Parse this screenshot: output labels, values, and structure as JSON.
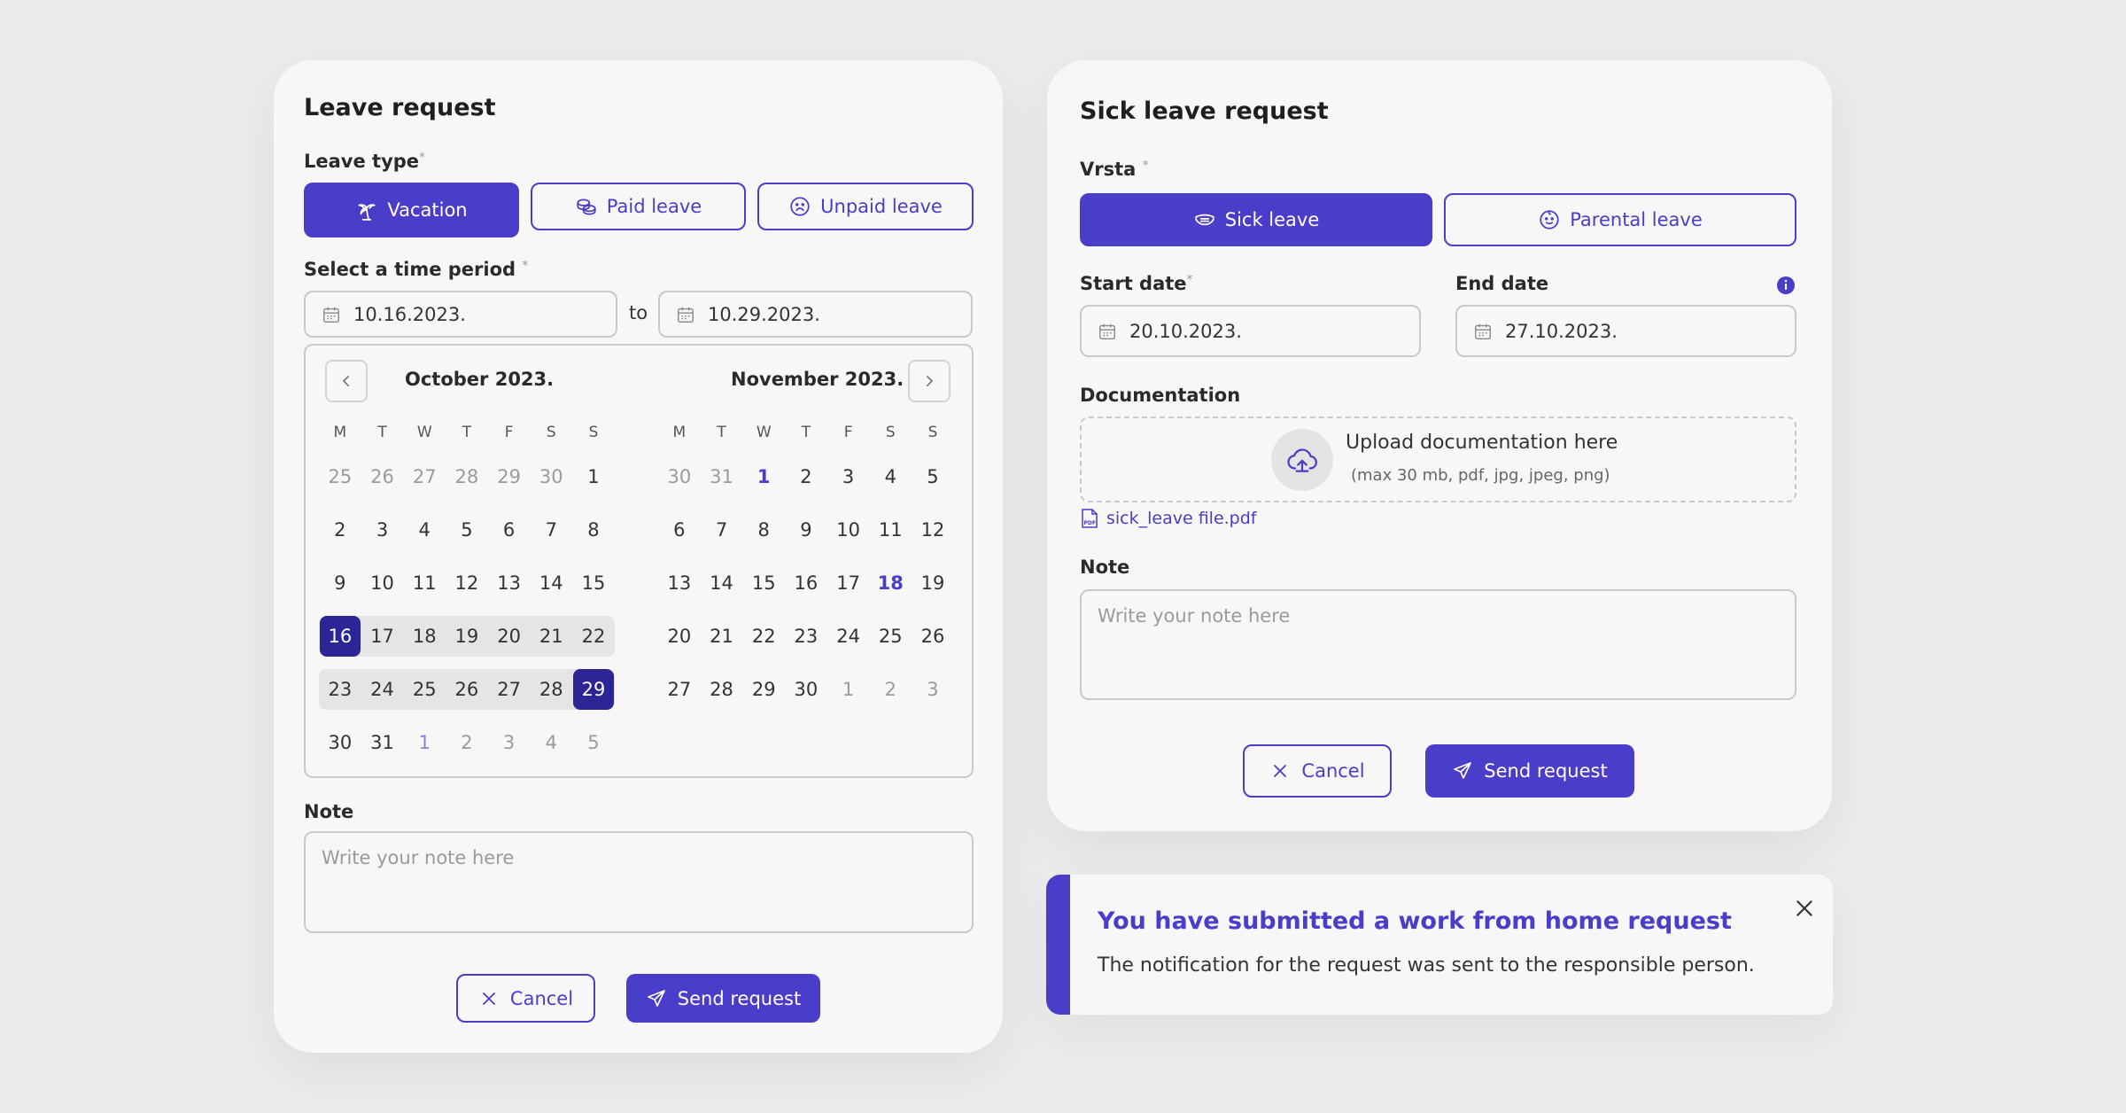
{
  "leave": {
    "title": "Leave request",
    "leave_type_label": "Leave type",
    "types": [
      "Vacation",
      "Paid leave",
      "Unpaid leave"
    ],
    "period_label": "Select a time period",
    "required_mark": "*",
    "start_value": "10.16.2023.",
    "to_label": "to",
    "end_value": "10.29.2023.",
    "note_label": "Note",
    "note_placeholder": "Write your note here",
    "cancel": "Cancel",
    "send": "Send request",
    "calendar": {
      "weekdays": [
        "M",
        "T",
        "W",
        "T",
        "F",
        "S",
        "S"
      ],
      "months": [
        {
          "title": "October 2023.",
          "days": [
            {
              "d": "25",
              "s": "muted"
            },
            {
              "d": "26",
              "s": "muted"
            },
            {
              "d": "27",
              "s": "muted"
            },
            {
              "d": "28",
              "s": "muted"
            },
            {
              "d": "29",
              "s": "muted"
            },
            {
              "d": "30",
              "s": "muted"
            },
            {
              "d": "1"
            },
            {
              "d": "2"
            },
            {
              "d": "3"
            },
            {
              "d": "4"
            },
            {
              "d": "5"
            },
            {
              "d": "6"
            },
            {
              "d": "7"
            },
            {
              "d": "8"
            },
            {
              "d": "9"
            },
            {
              "d": "10"
            },
            {
              "d": "11"
            },
            {
              "d": "12"
            },
            {
              "d": "13"
            },
            {
              "d": "14"
            },
            {
              "d": "15"
            },
            {
              "d": "16",
              "s": "sel range rs"
            },
            {
              "d": "17",
              "s": "range"
            },
            {
              "d": "18",
              "s": "range"
            },
            {
              "d": "19",
              "s": "range"
            },
            {
              "d": "20",
              "s": "range"
            },
            {
              "d": "21",
              "s": "range"
            },
            {
              "d": "22",
              "s": "range re"
            },
            {
              "d": "23",
              "s": "range rs"
            },
            {
              "d": "24",
              "s": "range"
            },
            {
              "d": "25",
              "s": "range"
            },
            {
              "d": "26",
              "s": "range"
            },
            {
              "d": "27",
              "s": "range"
            },
            {
              "d": "28",
              "s": "range"
            },
            {
              "d": "29",
              "s": "sel range re"
            },
            {
              "d": "30"
            },
            {
              "d": "31"
            },
            {
              "d": "1",
              "s": "accent-light"
            },
            {
              "d": "2",
              "s": "muted"
            },
            {
              "d": "3",
              "s": "muted"
            },
            {
              "d": "4",
              "s": "muted"
            },
            {
              "d": "5",
              "s": "muted"
            }
          ]
        },
        {
          "title": "November 2023.",
          "days": [
            {
              "d": "30",
              "s": "muted"
            },
            {
              "d": "31",
              "s": "muted"
            },
            {
              "d": "1",
              "s": "accent"
            },
            {
              "d": "2"
            },
            {
              "d": "3"
            },
            {
              "d": "4"
            },
            {
              "d": "5"
            },
            {
              "d": "6"
            },
            {
              "d": "7"
            },
            {
              "d": "8"
            },
            {
              "d": "9"
            },
            {
              "d": "10"
            },
            {
              "d": "11"
            },
            {
              "d": "12"
            },
            {
              "d": "13"
            },
            {
              "d": "14"
            },
            {
              "d": "15"
            },
            {
              "d": "16"
            },
            {
              "d": "17"
            },
            {
              "d": "18",
              "s": "accent"
            },
            {
              "d": "19"
            },
            {
              "d": "20"
            },
            {
              "d": "21"
            },
            {
              "d": "22"
            },
            {
              "d": "23"
            },
            {
              "d": "24"
            },
            {
              "d": "25"
            },
            {
              "d": "26"
            },
            {
              "d": "27"
            },
            {
              "d": "28"
            },
            {
              "d": "29"
            },
            {
              "d": "30"
            },
            {
              "d": "1",
              "s": "muted"
            },
            {
              "d": "2",
              "s": "muted"
            },
            {
              "d": "3",
              "s": "muted"
            }
          ]
        }
      ]
    }
  },
  "sick": {
    "title": "Sick leave request",
    "type_label": "Vrsta",
    "types": [
      "Sick leave",
      "Parental leave"
    ],
    "start_label": "Start date",
    "end_label": "End date",
    "start_value": "20.10.2023.",
    "end_value": "27.10.2023.",
    "doc_label": "Documentation",
    "upload_text": "Upload documentation here",
    "upload_hint": "(max 30 mb, pdf, jpg, jpeg, png)",
    "file_name": "sick_leave file.pdf",
    "pdf_badge": "PDF",
    "note_label": "Note",
    "note_placeholder": "Write your note here",
    "cancel": "Cancel",
    "send": "Send request"
  },
  "notification": {
    "title": "You have submitted a work from home request",
    "body": "The notification for the request was sent to the responsible person."
  },
  "colors": {
    "accent": "#4a3dc9",
    "selected_day": "#2d2596",
    "background": "#ebebeb",
    "card": "#f7f7f7"
  },
  "icons": [
    "palm-tree-icon",
    "coins-icon",
    "sad-face-icon",
    "calendar-icon",
    "chevron-left-icon",
    "chevron-right-icon",
    "close-icon",
    "send-icon",
    "mask-icon",
    "baby-face-icon",
    "info-icon",
    "cloud-upload-icon",
    "pdf-file-icon"
  ]
}
